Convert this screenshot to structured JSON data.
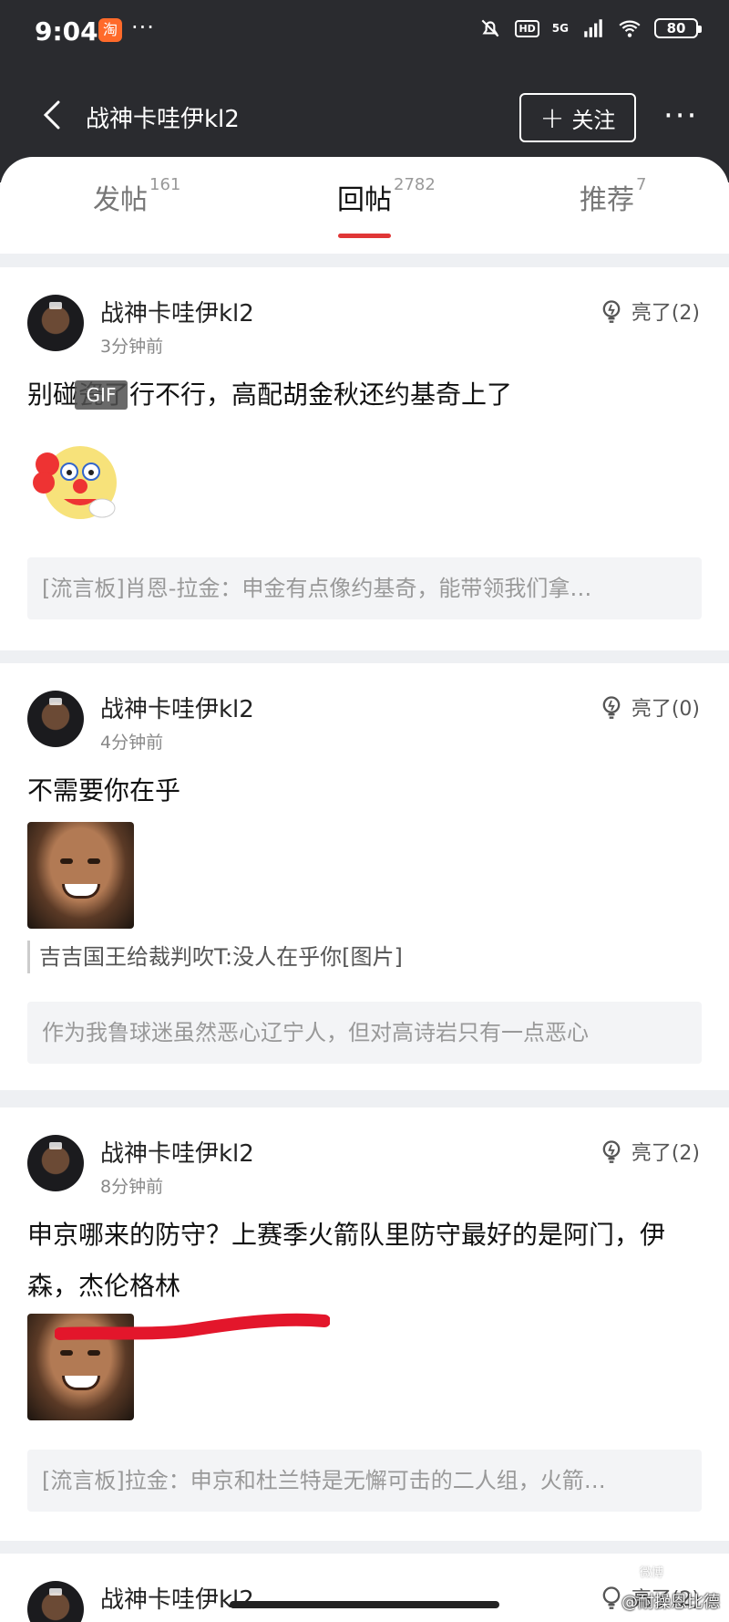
{
  "status_bar": {
    "time": "9:04",
    "app_icon_text": "淘",
    "dots": "···",
    "hd": "HD",
    "network": "5G",
    "battery": "80"
  },
  "nav": {
    "title": "战神卡哇伊kl2",
    "follow_label": "关注",
    "more": "···"
  },
  "tabs": [
    {
      "label": "发帖",
      "count": "161"
    },
    {
      "label": "回帖",
      "count": "2782"
    },
    {
      "label": "推荐",
      "count": "7"
    }
  ],
  "posts": [
    {
      "username": "战神卡哇伊kl2",
      "time": "3分钟前",
      "like_text": "亮了(2)",
      "content": "别碰瓷了行不行，高配胡金秋还约基奇上了",
      "image": "clown-gif",
      "gif_tag": "GIF",
      "board": "[流言板]肖恩-拉金：申金有点像约基奇，能带领我们拿…"
    },
    {
      "username": "战神卡哇伊kl2",
      "time": "4分钟前",
      "like_text": "亮了(0)",
      "content": "不需要你在乎",
      "image": "meme-face",
      "quote": "吉吉国王给裁判吹T:没人在乎你[图片]",
      "board": "作为我鲁球迷虽然恶心辽宁人，但对高诗岩只有一点恶心"
    },
    {
      "username": "战神卡哇伊kl2",
      "time": "8分钟前",
      "like_text": "亮了(2)",
      "content": "申京哪来的防守？上赛季火箭队里防守最好的是阿门，伊森，杰伦格林",
      "image": "meme-face",
      "board": "[流言板]拉金：申京和杜兰特是无懈可击的二人组，火箭…"
    },
    {
      "username": "战神卡哇伊kl2",
      "like_text": "亮了(2)"
    }
  ],
  "watermark": {
    "logo": "微博",
    "text": "@耐操恩比德"
  },
  "colors": {
    "header_bg": "#2a2b2f",
    "accent": "#e03636",
    "page_bg": "#eef0f3"
  }
}
